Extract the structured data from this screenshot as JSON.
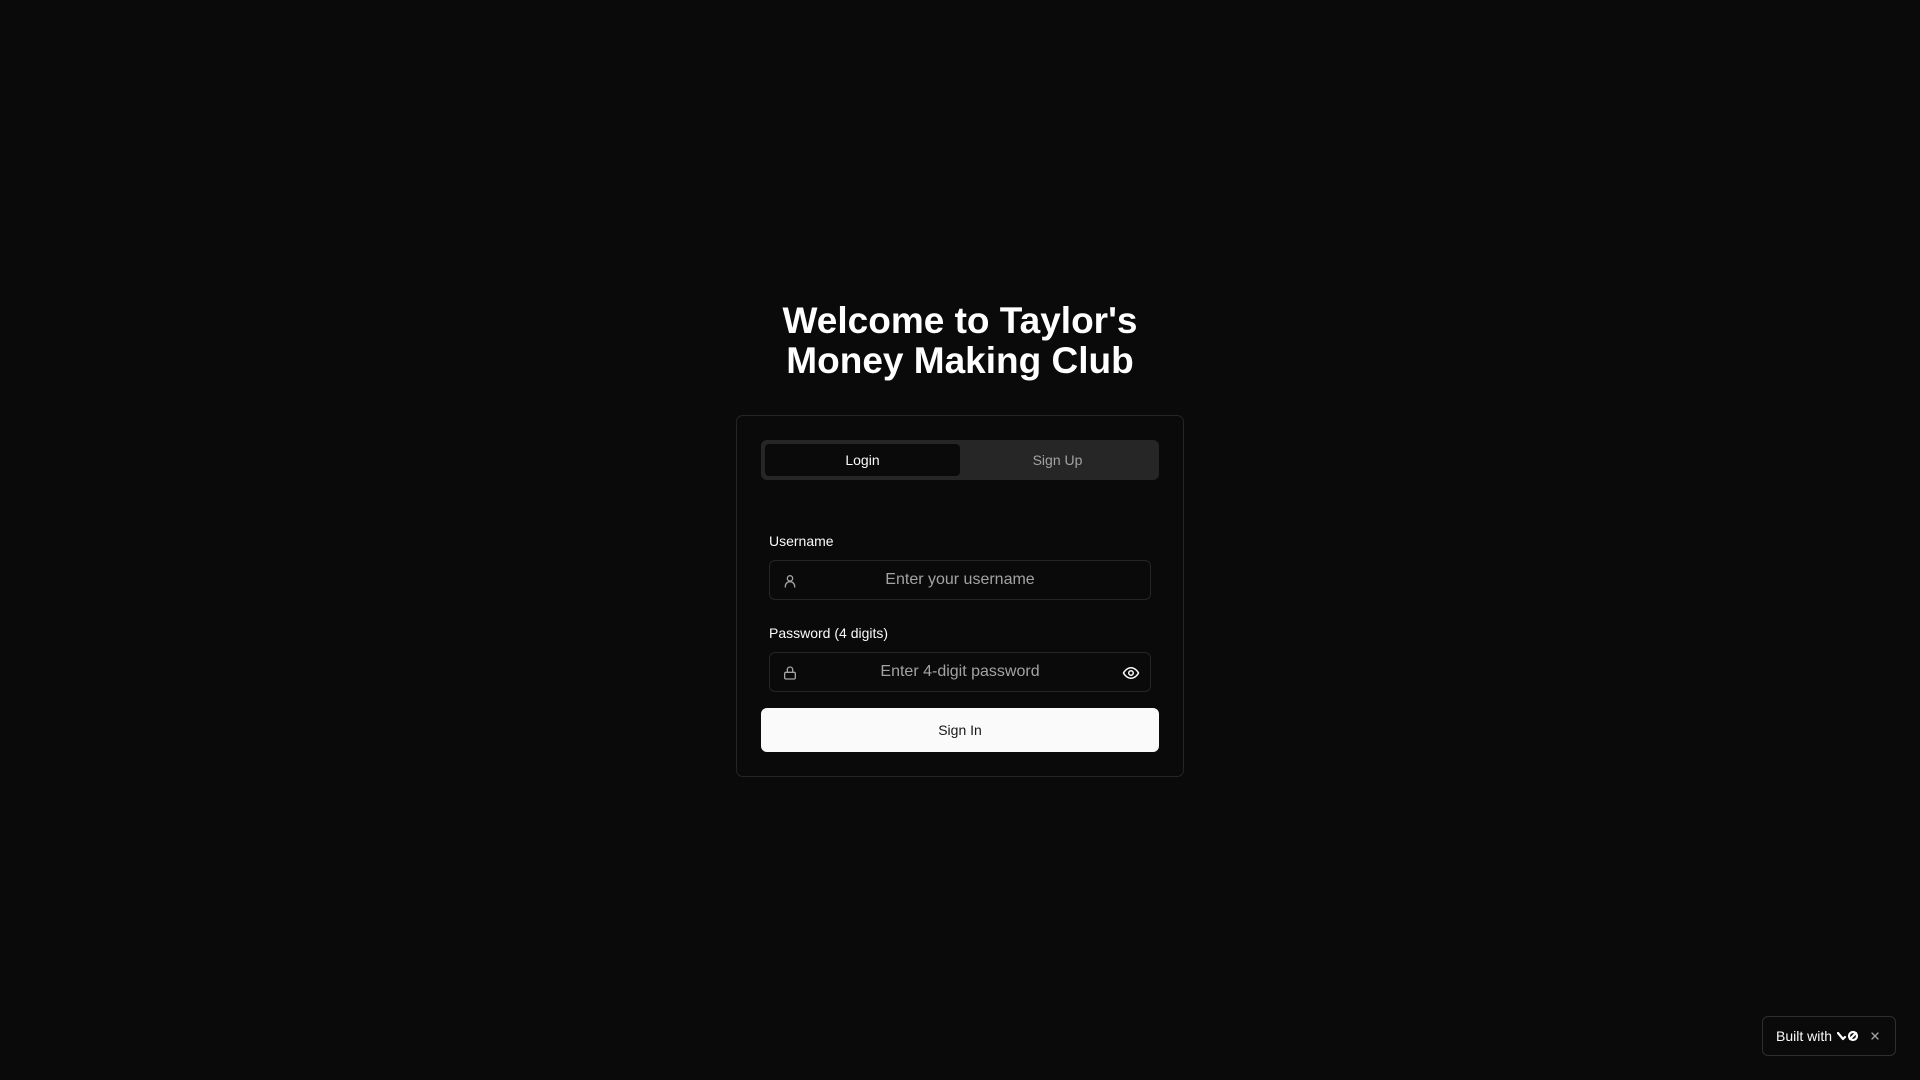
{
  "page": {
    "title_line1": "Welcome to Taylor's",
    "title_line2": "Money Making Club"
  },
  "tabs": [
    {
      "label": "Login",
      "active": true
    },
    {
      "label": "Sign Up",
      "active": false
    }
  ],
  "form": {
    "username_label": "Username",
    "username_placeholder": "Enter your username",
    "username_value": "",
    "password_label": "Password (4 digits)",
    "password_placeholder": "Enter 4-digit password",
    "password_value": "",
    "submit_label": "Sign In"
  },
  "icons": {
    "username": "user-icon",
    "password": "lock-icon",
    "toggle_password": "eye-icon",
    "badge_logo": "v0-logo-icon",
    "badge_close": "close-icon"
  },
  "badge": {
    "label": "Built with"
  },
  "colors": {
    "background": "#0a0a0a",
    "border": "#262626",
    "tab_track": "#262626",
    "primary_button": "#fafafa",
    "muted_text": "#a3a3a3"
  }
}
